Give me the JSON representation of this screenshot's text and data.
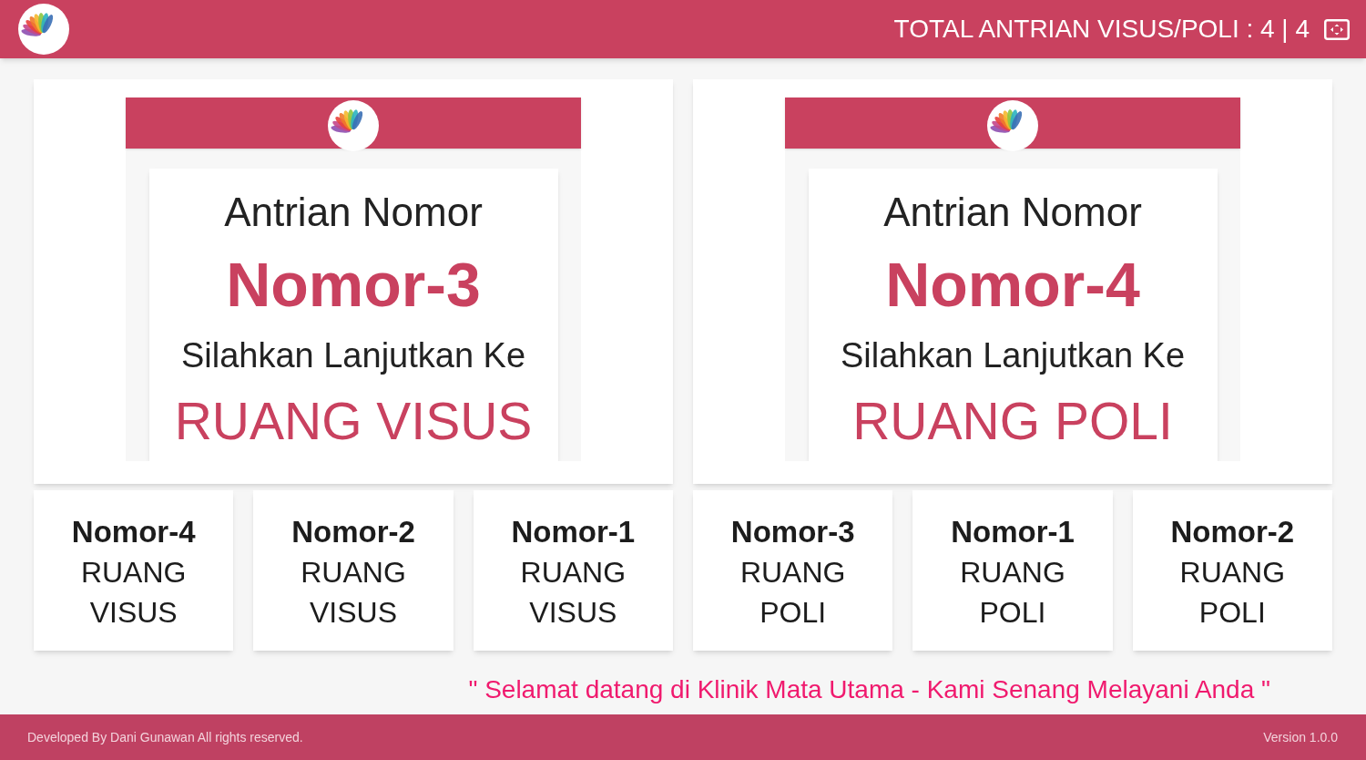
{
  "header": {
    "title": "TOTAL ANTRIAN VISUS/POLI : 4 | 4"
  },
  "now_calling": [
    {
      "heading": "Antrian Nomor",
      "number": "Nomor-3",
      "instruction": "Silahkan Lanjutkan Ke",
      "room": "RUANG VISUS"
    },
    {
      "heading": "Antrian Nomor",
      "number": "Nomor-4",
      "instruction": "Silahkan Lanjutkan Ke",
      "room": "RUANG POLI"
    }
  ],
  "queue": [
    {
      "number": "Nomor-4",
      "room": "RUANG VISUS"
    },
    {
      "number": "Nomor-2",
      "room": "RUANG VISUS"
    },
    {
      "number": "Nomor-1",
      "room": "RUANG VISUS"
    },
    {
      "number": "Nomor-3",
      "room": "RUANG POLI"
    },
    {
      "number": "Nomor-1",
      "room": "RUANG POLI"
    },
    {
      "number": "Nomor-2",
      "room": "RUANG POLI"
    }
  ],
  "marquee": "\" Selamat datang di Klinik Mata Utama - Kami Senang Melayani Anda \"",
  "footer": {
    "credit": "Developed By Dani Gunawan All rights reserved.",
    "version": "Version 1.0.0"
  }
}
